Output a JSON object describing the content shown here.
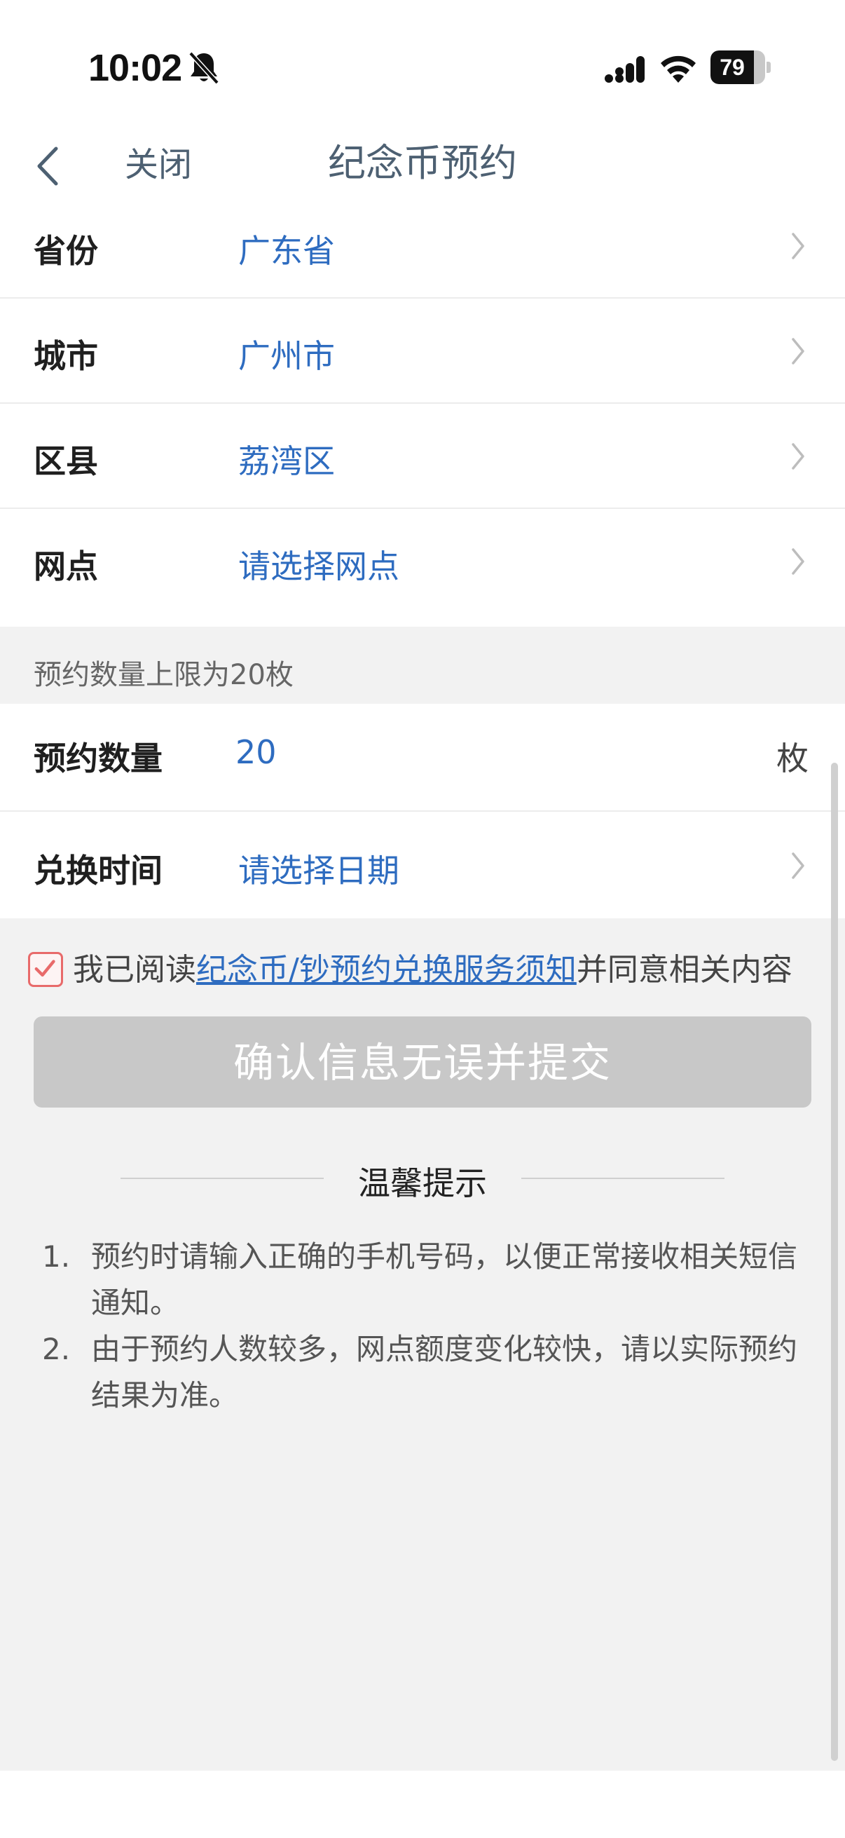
{
  "status_bar": {
    "time": "10:02",
    "battery": "79"
  },
  "nav": {
    "back_icon": "chevron-left-icon",
    "close_label": "关闭",
    "title": "纪念币预约"
  },
  "location_rows": [
    {
      "label": "省份",
      "value": "广东省"
    },
    {
      "label": "城市",
      "value": "广州市"
    },
    {
      "label": "区县",
      "value": "荔湾区"
    },
    {
      "label": "网点",
      "value": "请选择网点"
    }
  ],
  "limit_note": "预约数量上限为20枚",
  "quantity": {
    "label": "预约数量",
    "value": "20",
    "unit": "枚"
  },
  "exchange_time": {
    "label": "兑换时间",
    "value": "请选择日期"
  },
  "agreement": {
    "checked": true,
    "prefix": "我已阅读",
    "link": "纪念币/钞预约兑换服务须知",
    "suffix": "并同意相关内容"
  },
  "submit_label": "确认信息无误并提交",
  "tips": {
    "title": "温馨提示",
    "items": [
      {
        "num": "1.",
        "text": "预约时请输入正确的手机号码，以便正常接收相关短信通知。"
      },
      {
        "num": "2.",
        "text": "由于预约人数较多，网点额度变化较快，请以实际预约结果为准。"
      }
    ]
  },
  "colors": {
    "value_blue": "#2e6cc0",
    "button_disabled": "#c8c8c8",
    "checkbox_red": "#e86a6a"
  }
}
